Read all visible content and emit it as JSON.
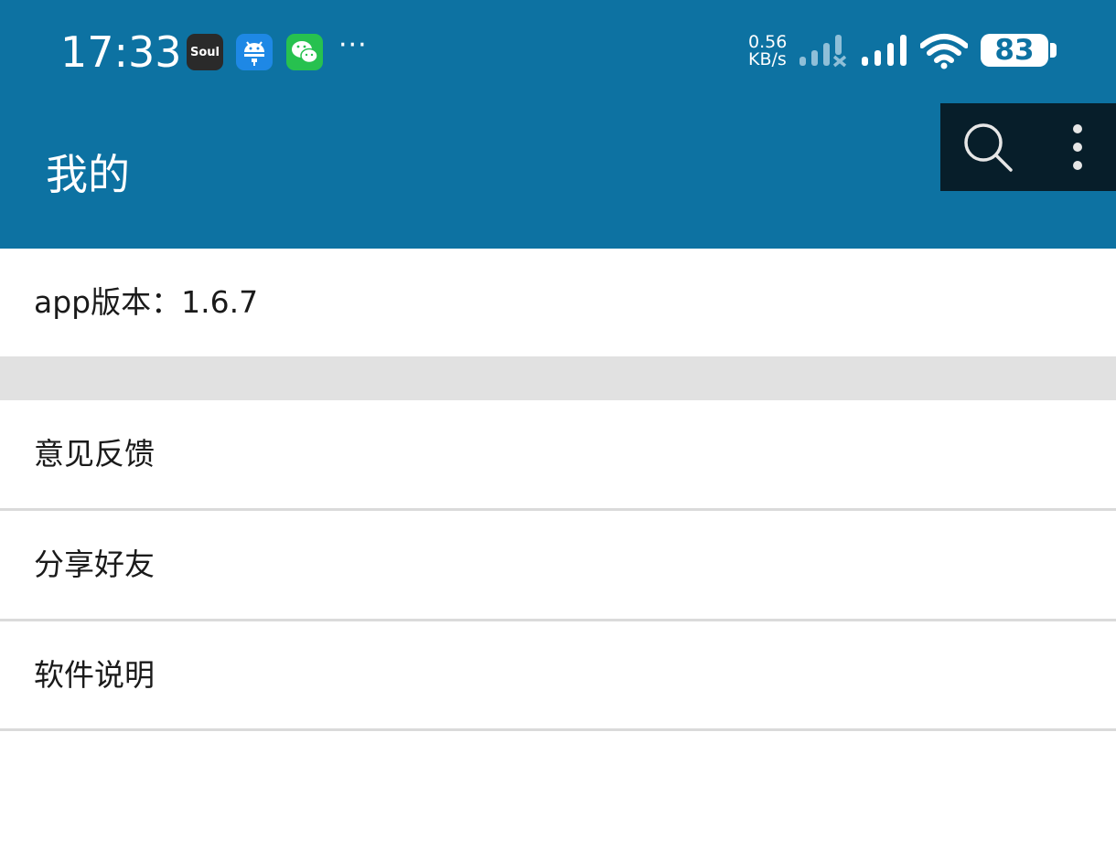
{
  "status_bar": {
    "time": "17:33",
    "notifications": {
      "soul_label": "Soul",
      "more": "···"
    },
    "net_speed_value": "0.56",
    "net_speed_unit": "KB/s",
    "battery_level": "83"
  },
  "app_bar": {
    "title": "我的"
  },
  "list": {
    "version_label": "app版本：1.6.7",
    "items": [
      {
        "label": "意见反馈"
      },
      {
        "label": "分享好友"
      },
      {
        "label": "软件说明"
      }
    ]
  },
  "colors": {
    "primary": "#0d72a2",
    "action_box": "#071e2a",
    "separator": "#e1e1e1",
    "divider": "#dadada"
  },
  "icons": [
    "search-icon",
    "more-vert-icon",
    "signal-icon",
    "wifi-icon",
    "battery-icon"
  ]
}
